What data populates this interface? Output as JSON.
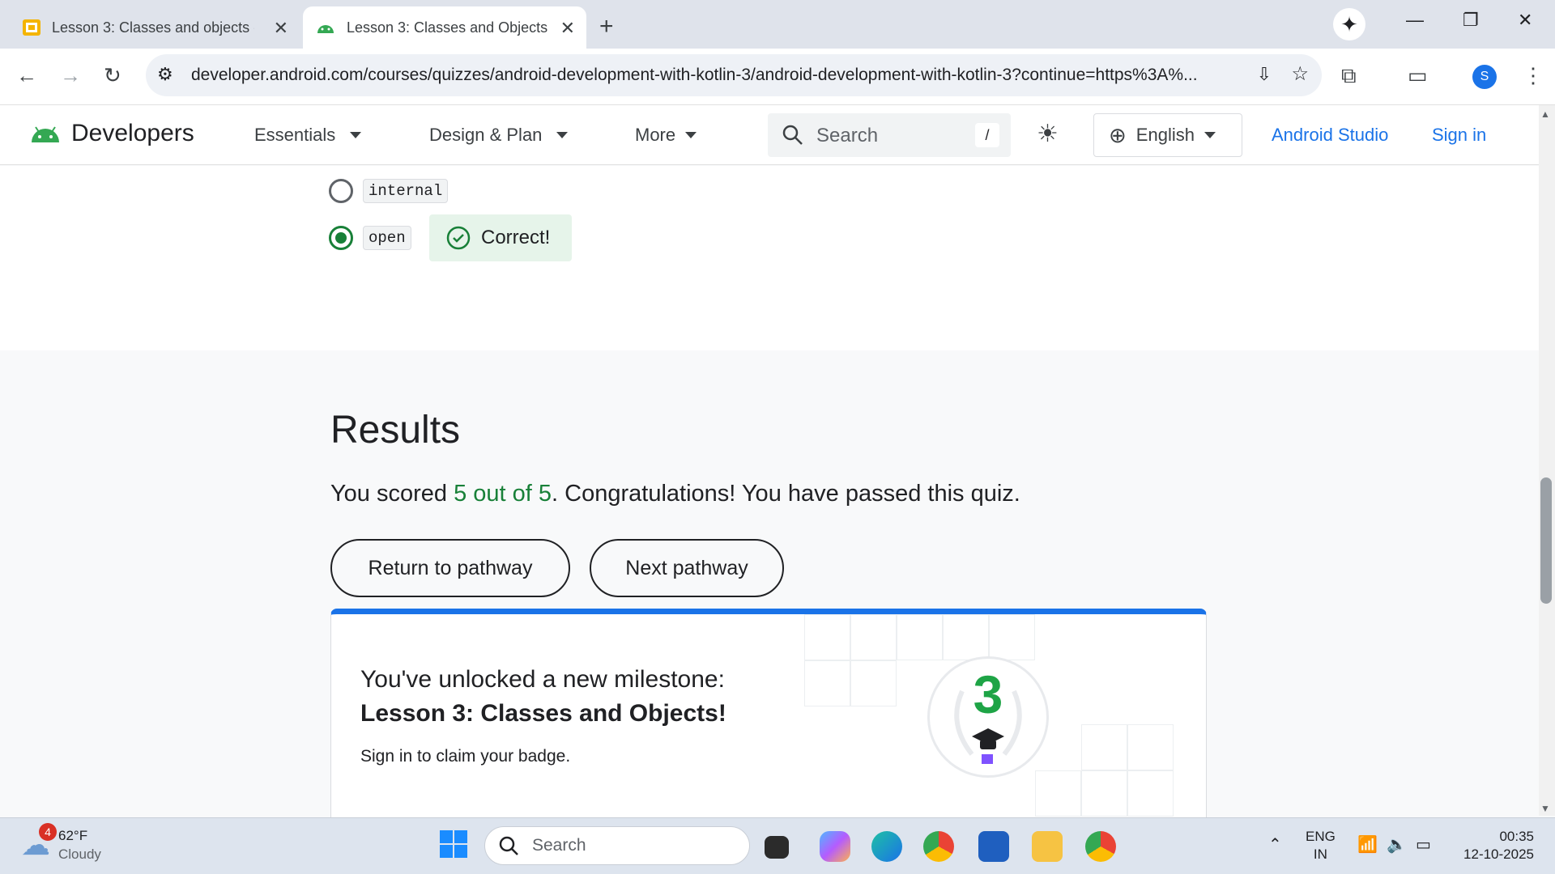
{
  "browser": {
    "tabs": [
      {
        "title": "Lesson 3: Classes and objects - "
      },
      {
        "title": "Lesson 3: Classes and Objects |"
      }
    ],
    "url": "developer.android.com/courses/quizzes/android-development-with-kotlin-3/android-development-with-kotlin-3?continue=https%3A%...",
    "profile_initial": "S"
  },
  "site_header": {
    "logo_text": "Developers",
    "nav": [
      "Essentials",
      "Design & Plan",
      "More"
    ],
    "search_placeholder": "Search",
    "search_shortcut": "/",
    "language": "English",
    "links": [
      "Android Studio",
      "Sign in"
    ]
  },
  "quiz": {
    "options": [
      {
        "label": "internal",
        "selected": false
      },
      {
        "label": "open",
        "selected": true
      }
    ],
    "feedback": "Correct!"
  },
  "results": {
    "title": "Results",
    "score_prefix": "You scored ",
    "score_value": "5 out of 5",
    "score_suffix": ". Congratulations! You have passed this quiz.",
    "buttons": [
      "Return to pathway",
      "Next pathway"
    ]
  },
  "milestone": {
    "line1": "You've unlocked a new milestone:",
    "line2": "Lesson 3: Classes and Objects!",
    "line3": "Sign in to claim your badge.",
    "badge_number": "3"
  },
  "taskbar": {
    "weather_temp": "62°F",
    "weather_desc": "Cloudy",
    "weather_badge": "4",
    "search_placeholder": "Search",
    "lang_line1": "ENG",
    "lang_line2": "IN",
    "time": "00:35",
    "date": "12-10-2025"
  },
  "colors": {
    "accent_blue": "#1a73e8",
    "success_green": "#188038"
  }
}
